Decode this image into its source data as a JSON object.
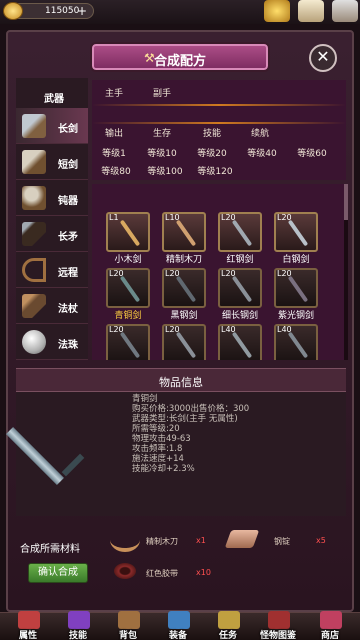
{
  "topbar": {
    "gold": "115050",
    "gold_plus": "+"
  },
  "title": "合成配方",
  "close_symbol": "✕",
  "categories": [
    {
      "label": "武器",
      "icon": "weapon-header",
      "active": false
    },
    {
      "label": "长剑",
      "icon": "longsword-icon",
      "active": true
    },
    {
      "label": "短剑",
      "icon": "shortsword-icon",
      "active": false
    },
    {
      "label": "钝器",
      "icon": "hammer-icon",
      "active": false
    },
    {
      "label": "长矛",
      "icon": "spear-icon",
      "active": false
    },
    {
      "label": "远程",
      "icon": "bow-icon",
      "active": false
    },
    {
      "label": "法杖",
      "icon": "staff-icon",
      "active": false
    },
    {
      "label": "法珠",
      "icon": "orb-icon",
      "active": false
    }
  ],
  "filters": {
    "hand": [
      "主手",
      "副手"
    ],
    "type": [
      "输出",
      "生存",
      "技能",
      "续航"
    ],
    "levels_row1": [
      "等级1",
      "等级10",
      "等级20",
      "等级40",
      "等级60"
    ],
    "levels_row2": [
      "等级80",
      "等级100",
      "等级120"
    ]
  },
  "items": [
    {
      "level": "L1",
      "name": "小木剑",
      "color": "#d8a860",
      "selected": false
    },
    {
      "level": "L10",
      "name": "精制木刀",
      "color": "#d0a070",
      "selected": false
    },
    {
      "level": "L20",
      "name": "红钢剑",
      "color": "#a0a8b0",
      "selected": false
    },
    {
      "level": "L20",
      "name": "白钢剑",
      "color": "#b8c0c8",
      "selected": false
    },
    {
      "level": "L20",
      "name": "青铜剑",
      "color": "#6a8a8a",
      "selected": true
    },
    {
      "level": "L20",
      "name": "黑钢剑",
      "color": "#606870",
      "selected": false
    },
    {
      "level": "L20",
      "name": "细长钢剑",
      "color": "#8a9098",
      "selected": false
    },
    {
      "level": "L20",
      "name": "紫光钢剑",
      "color": "#7a7080",
      "selected": false
    },
    {
      "level": "L20",
      "name": "",
      "color": "#707880",
      "selected": false
    },
    {
      "level": "L20",
      "name": "",
      "color": "#8a9098",
      "selected": false
    },
    {
      "level": "L40",
      "name": "",
      "color": "#909aa0",
      "selected": false
    },
    {
      "level": "L40",
      "name": "",
      "color": "#808890",
      "selected": false
    }
  ],
  "info": {
    "header": "物品信息",
    "lines": [
      "青铜剑",
      "购买价格:3000出售价格：300",
      "武器类型:长剑(主手 无属性)",
      "所需等级:20",
      "物理攻击49-63",
      "攻击频率:1.8",
      "施法速度+14",
      "技能冷却+2.3%"
    ]
  },
  "materials": {
    "label": "合成所需材料",
    "confirm": "确认合成",
    "list": [
      {
        "name": "精制木刀",
        "qty": "x1",
        "icon": "wooden-blade-icon"
      },
      {
        "name": "钢锭",
        "qty": "x5",
        "icon": "steel-ingot-icon"
      },
      {
        "name": "红色胶带",
        "qty": "x10",
        "icon": "red-tape-icon"
      }
    ]
  },
  "nav": [
    {
      "label": "属性",
      "color": "#c04040"
    },
    {
      "label": "技能",
      "color": "#8040c0"
    },
    {
      "label": "背包",
      "color": "#a07040"
    },
    {
      "label": "装备",
      "color": "#4080c0"
    },
    {
      "label": "任务",
      "color": "#c0a040"
    },
    {
      "label": "怪物图鉴",
      "color": "#a03030"
    },
    {
      "label": "商店",
      "color": "#c04060"
    }
  ]
}
